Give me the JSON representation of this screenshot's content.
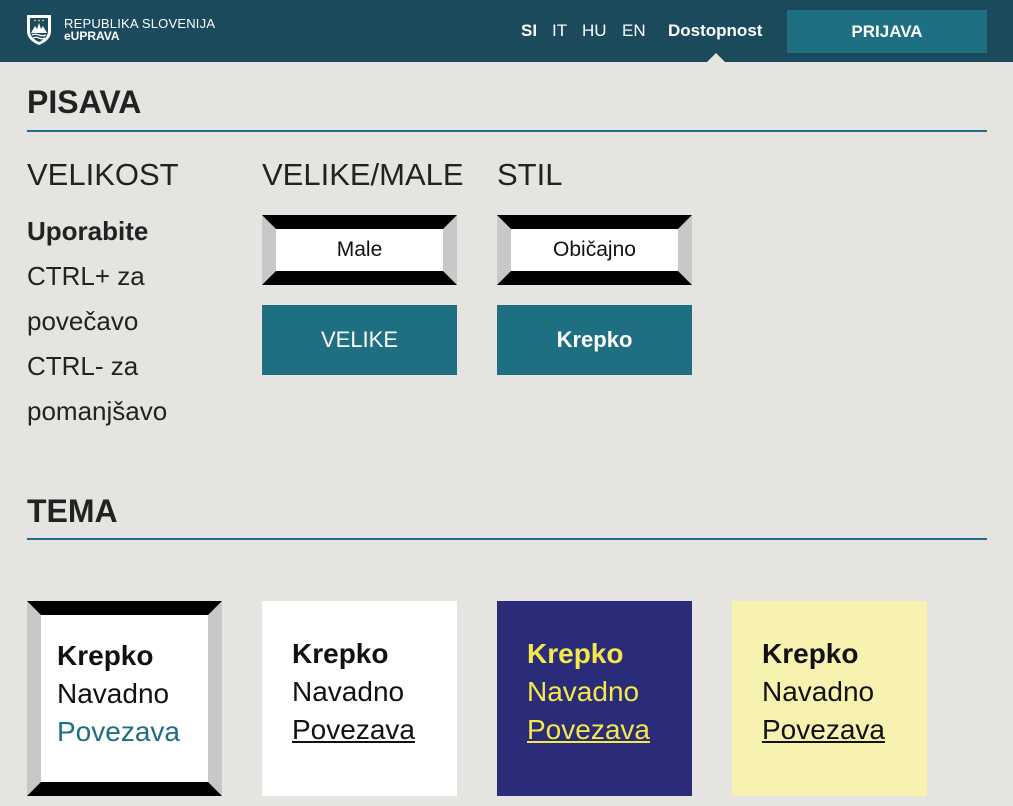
{
  "header": {
    "brand_line1": "REPUBLIKA SLOVENIJA",
    "brand_line2": "eUPRAVA",
    "languages": [
      "SI",
      "IT",
      "HU",
      "EN"
    ],
    "active_language": "SI",
    "accessibility_label": "Dostopnost",
    "login_label": "PRIJAVA"
  },
  "font_section": {
    "title": "PISAVA",
    "size": {
      "heading": "VELIKOST",
      "text_bold": "Uporabite",
      "text_line1": "CTRL+ za",
      "text_line2": "povečavo",
      "text_line3": "CTRL- za",
      "text_line4": "pomanjšavo"
    },
    "case": {
      "heading": "VELIKE/MALE",
      "selected_label": "Male",
      "other_label": "VELIKE"
    },
    "style": {
      "heading": "STIL",
      "selected_label": "Običajno",
      "other_label": "Krepko"
    }
  },
  "theme_section": {
    "title": "TEMA",
    "themes": [
      {
        "bold": "Krepko",
        "normal": "Navadno",
        "link": "Povezava",
        "bg": "#ffffff",
        "text": "#111111",
        "link_color": "#1e6f82",
        "selected": true
      },
      {
        "bold": "Krepko",
        "normal": "Navadno",
        "link": "Povezava",
        "bg": "#ffffff",
        "text": "#111111",
        "link_color": "#111111",
        "selected": false
      },
      {
        "bold": "Krepko",
        "normal": "Navadno",
        "link": "Povezava",
        "bg": "#2a2c7a",
        "text": "#f5e84a",
        "link_color": "#f5e84a",
        "selected": false
      },
      {
        "bold": "Krepko",
        "normal": "Navadno",
        "link": "Povezava",
        "bg": "#f7f2b0",
        "text": "#111111",
        "link_color": "#111111",
        "selected": false
      }
    ]
  }
}
